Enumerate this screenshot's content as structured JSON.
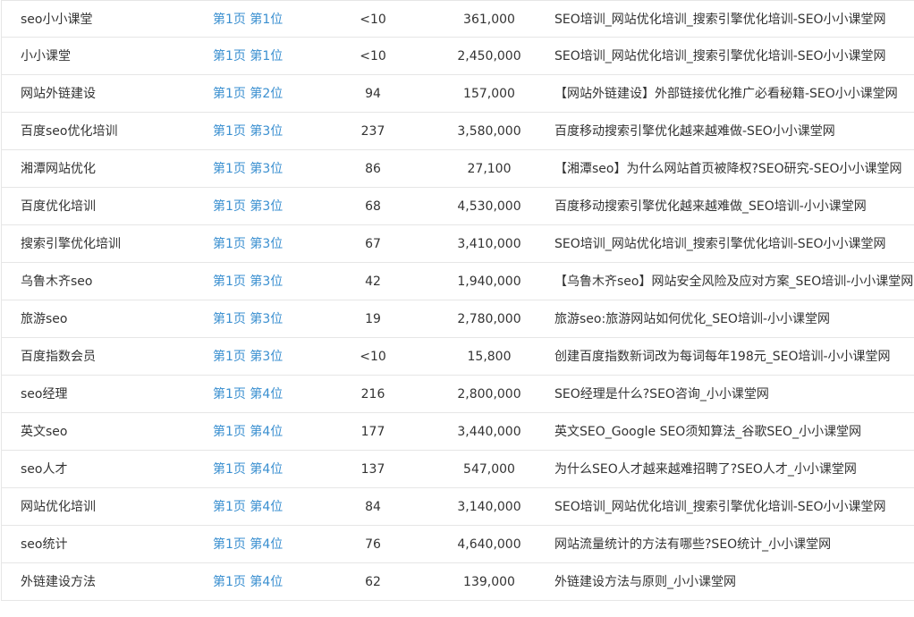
{
  "rows": [
    {
      "keyword": "seo小小课堂",
      "rank": "第1页 第1位",
      "index": "<10",
      "results": "361,000",
      "title": "SEO培训_网站优化培训_搜索引擎优化培训-SEO小小课堂网"
    },
    {
      "keyword": "小小课堂",
      "rank": "第1页 第1位",
      "index": "<10",
      "results": "2,450,000",
      "title": "SEO培训_网站优化培训_搜索引擎优化培训-SEO小小课堂网"
    },
    {
      "keyword": "网站外链建设",
      "rank": "第1页 第2位",
      "index": "94",
      "results": "157,000",
      "title": "【网站外链建设】外部链接优化推广必看秘籍-SEO小小课堂网"
    },
    {
      "keyword": "百度seo优化培训",
      "rank": "第1页 第3位",
      "index": "237",
      "results": "3,580,000",
      "title": "百度移动搜索引擎优化越来越难做-SEO小小课堂网"
    },
    {
      "keyword": "湘潭网站优化",
      "rank": "第1页 第3位",
      "index": "86",
      "results": "27,100",
      "title": "【湘潭seo】为什么网站首页被降权?SEO研究-SEO小小课堂网"
    },
    {
      "keyword": "百度优化培训",
      "rank": "第1页 第3位",
      "index": "68",
      "results": "4,530,000",
      "title": "百度移动搜索引擎优化越来越难做_SEO培训-小小课堂网"
    },
    {
      "keyword": "搜索引擎优化培训",
      "rank": "第1页 第3位",
      "index": "67",
      "results": "3,410,000",
      "title": "SEO培训_网站优化培训_搜索引擎优化培训-SEO小小课堂网"
    },
    {
      "keyword": "乌鲁木齐seo",
      "rank": "第1页 第3位",
      "index": "42",
      "results": "1,940,000",
      "title": "【乌鲁木齐seo】网站安全风险及应对方案_SEO培训-小小课堂网"
    },
    {
      "keyword": "旅游seo",
      "rank": "第1页 第3位",
      "index": "19",
      "results": "2,780,000",
      "title": "旅游seo:旅游网站如何优化_SEO培训-小小课堂网"
    },
    {
      "keyword": "百度指数会员",
      "rank": "第1页 第3位",
      "index": "<10",
      "results": "15,800",
      "title": "创建百度指数新词改为每词每年198元_SEO培训-小小课堂网"
    },
    {
      "keyword": "seo经理",
      "rank": "第1页 第4位",
      "index": "216",
      "results": "2,800,000",
      "title": "SEO经理是什么?SEO咨询_小小课堂网"
    },
    {
      "keyword": "英文seo",
      "rank": "第1页 第4位",
      "index": "177",
      "results": "3,440,000",
      "title": "英文SEO_Google SEO须知算法_谷歌SEO_小小课堂网"
    },
    {
      "keyword": "seo人才",
      "rank": "第1页 第4位",
      "index": "137",
      "results": "547,000",
      "title": "为什么SEO人才越来越难招聘了?SEO人才_小小课堂网"
    },
    {
      "keyword": "网站优化培训",
      "rank": "第1页 第4位",
      "index": "84",
      "results": "3,140,000",
      "title": "SEO培训_网站优化培训_搜索引擎优化培训-SEO小小课堂网"
    },
    {
      "keyword": "seo统计",
      "rank": "第1页 第4位",
      "index": "76",
      "results": "4,640,000",
      "title": "网站流量统计的方法有哪些?SEO统计_小小课堂网"
    },
    {
      "keyword": "外链建设方法",
      "rank": "第1页 第4位",
      "index": "62",
      "results": "139,000",
      "title": "外链建设方法与原则_小小课堂网"
    }
  ]
}
